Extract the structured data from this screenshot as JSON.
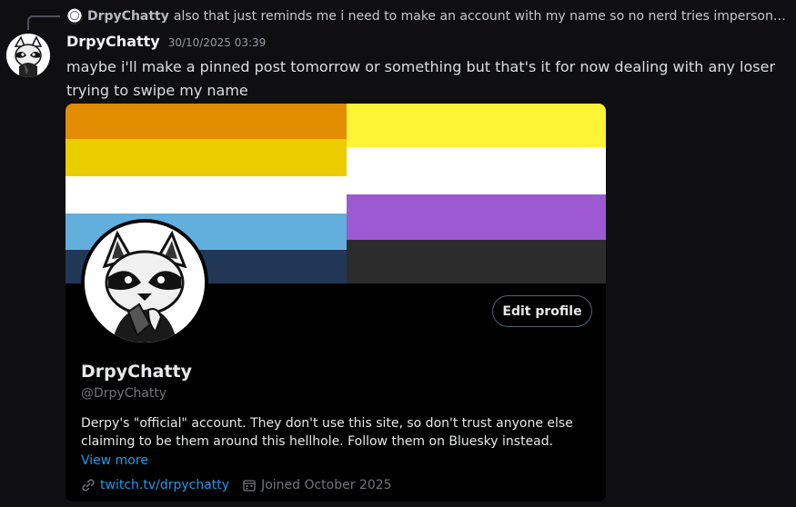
{
  "reply": {
    "author": "DrpyChatty",
    "text": "also that just reminds me i need to make an account with my name so no nerd tries impersonatin..."
  },
  "message": {
    "author": "DrpyChatty",
    "timestamp": "30/10/2025 03:39",
    "content": "maybe i'll make a pinned post tomorrow or something but that's it for now dealing with any loser trying to swipe my name"
  },
  "profile": {
    "edit_label": "Edit profile",
    "display_name": "DrpyChatty",
    "handle": "@DrpyChatty",
    "bio": "Derpy's \"official\" account. They don't use this site, so don't trust anyone else claiming to be them around this hellhole. Follow them on Bluesky instead.",
    "view_more": "View more",
    "link": "twitch.tv/drpychatty",
    "joined": "Joined October 2025"
  },
  "colors": {
    "aroace_flag": [
      "#e28c00",
      "#eccd00",
      "#ffffff",
      "#62aedc",
      "#203856"
    ],
    "nonbinary_flag": [
      "#fcf434",
      "#ffffff",
      "#9c59d1",
      "#2c2c2c"
    ],
    "link": "#1d9bf0"
  },
  "icons": [
    "link-icon",
    "calendar-icon"
  ]
}
